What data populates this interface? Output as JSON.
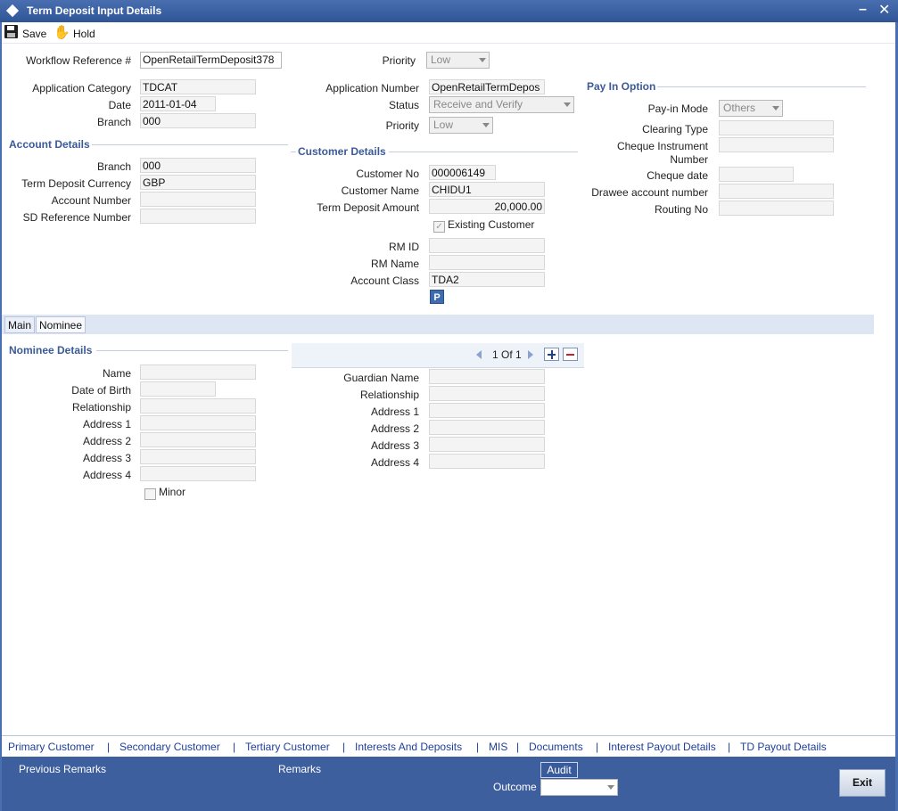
{
  "window": {
    "title": "Term Deposit Input Details"
  },
  "toolbar": {
    "save_label": "Save",
    "hold_label": "Hold"
  },
  "header": {
    "workflow_ref_label": "Workflow Reference #",
    "workflow_ref_value": "OpenRetailTermDeposit378",
    "priority_label": "Priority",
    "priority_value": "Low",
    "app_category_label": "Application Category",
    "app_category_value": "TDCAT",
    "date_label": "Date",
    "date_value": "2011-01-04",
    "branch_label": "Branch",
    "branch_value": "000",
    "app_number_label": "Application Number",
    "app_number_value": "OpenRetailTermDepos",
    "status_label": "Status",
    "status_value": "Receive and Verify",
    "priority2_label": "Priority",
    "priority2_value": "Low"
  },
  "account_details": {
    "title": "Account Details",
    "branch_label": "Branch",
    "branch_value": "000",
    "currency_label": "Term Deposit Currency",
    "currency_value": "GBP",
    "account_number_label": "Account Number",
    "account_number_value": "",
    "sd_ref_label": "SD Reference Number",
    "sd_ref_value": ""
  },
  "customer_details": {
    "title": "Customer Details",
    "customer_no_label": "Customer No",
    "customer_no_value": "000006149",
    "customer_name_label": "Customer Name",
    "customer_name_value": "CHIDU1",
    "td_amount_label": "Term Deposit Amount",
    "td_amount_value": "20,000.00",
    "existing_customer_label": "Existing Customer",
    "existing_customer_checked": true,
    "rm_id_label": "RM ID",
    "rm_id_value": "",
    "rm_name_label": "RM Name",
    "rm_name_value": "",
    "account_class_label": "Account Class",
    "account_class_value": "TDA2",
    "p_button_label": "P"
  },
  "pay_in": {
    "title": "Pay In Option",
    "mode_label": "Pay-in Mode",
    "mode_value": "Others",
    "clearing_type_label": "Clearing Type",
    "cheque_instr_label": "Cheque Instrument",
    "cheque_instr_label2": "Number",
    "cheque_date_label": "Cheque date",
    "drawee_label": "Drawee account number",
    "routing_label": "Routing No"
  },
  "tabs": [
    {
      "label": "Main"
    },
    {
      "label": "Nominee"
    }
  ],
  "nominee": {
    "title": "Nominee Details",
    "pager_text": "1 Of 1",
    "name_label": "Name",
    "dob_label": "Date of Birth",
    "relationship_label": "Relationship",
    "address1_label": "Address 1",
    "address2_label": "Address 2",
    "address3_label": "Address 3",
    "address4_label": "Address 4",
    "minor_label": "Minor",
    "guardian_name_label": "Guardian Name",
    "g_relationship_label": "Relationship",
    "g_address1_label": "Address 1",
    "g_address2_label": "Address 2",
    "g_address3_label": "Address 3",
    "g_address4_label": "Address 4"
  },
  "links": [
    "Primary Customer",
    "Secondary Customer",
    "Tertiary Customer",
    "Interests And Deposits",
    "MIS",
    "Documents",
    "Interest Payout Details",
    "TD Payout Details"
  ],
  "footer": {
    "previous_remarks_label": "Previous Remarks",
    "remarks_label": "Remarks",
    "audit_label": "Audit",
    "outcome_label": "Outcome",
    "exit_label": "Exit"
  }
}
